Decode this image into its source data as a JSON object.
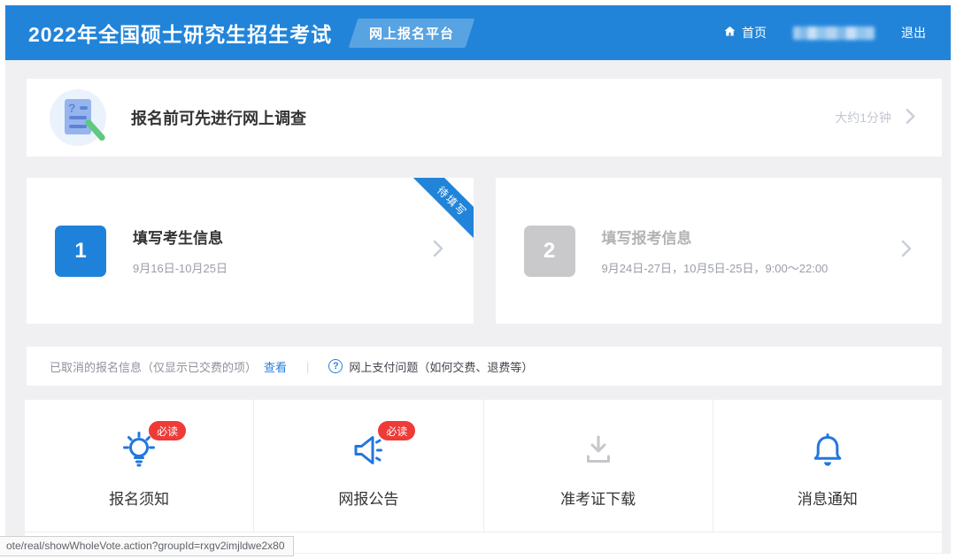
{
  "header": {
    "title": "2022年全国硕士研究生招生考试",
    "badge": "网上报名平台",
    "home_label": "首页",
    "logout_label": "退出"
  },
  "survey": {
    "title": "报名前可先进行网上调查",
    "duration": "大约1分钟"
  },
  "steps": [
    {
      "number": "1",
      "title": "填写考生信息",
      "date": "9月16日-10月25日",
      "ribbon": "待填写",
      "state": "active"
    },
    {
      "number": "2",
      "title": "填写报考信息",
      "date": "9月24日-27日，10月5日-25日，9:00～22:00",
      "state": "disabled"
    }
  ],
  "cancel_bar": {
    "info_text": "已取消的报名信息（仅显示已交费的项）",
    "view_link": "查看",
    "help_icon": "?",
    "help_text": "网上支付问题（如何交费、退费等）"
  },
  "quick_links": [
    {
      "label": "报名须知",
      "icon": "lightbulb-icon",
      "badge": "必读"
    },
    {
      "label": "网报公告",
      "icon": "megaphone-icon",
      "badge": "必读"
    },
    {
      "label": "准考证下载",
      "icon": "download-icon"
    },
    {
      "label": "消息通知",
      "icon": "bell-icon"
    }
  ],
  "status_bar": {
    "url": "ote/real/showWholeVote.action?groupId=rxgv2imjldwe2x80"
  },
  "colors": {
    "accent": "#2184d9",
    "danger": "#ee3b37",
    "disabled": "#c9c9cc",
    "link": "#2a7de0"
  }
}
